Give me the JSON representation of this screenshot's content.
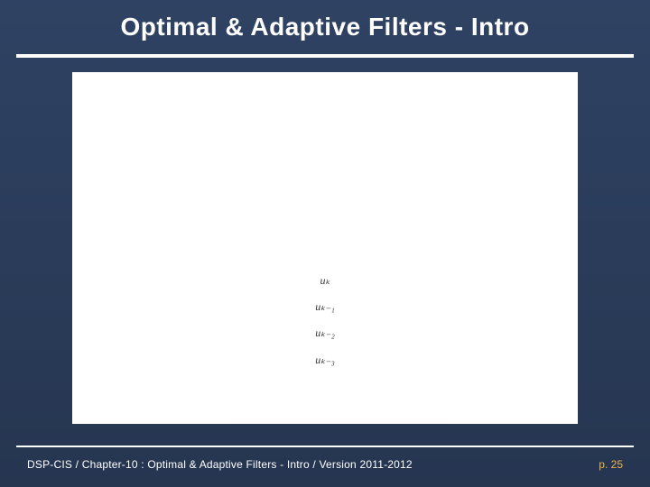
{
  "title": "Optimal & Adaptive Filters - Intro",
  "signals": {
    "s0": "uₖ",
    "s1": "uₖ₋₁",
    "s2": "uₖ₋₂",
    "s3": "uₖ₋₃"
  },
  "footer": {
    "course": "DSP-CIS",
    "sep": "  /  ",
    "chapter": "Chapter-10 : Optimal & Adaptive Filters - Intro",
    "version": "Version 2011-2012",
    "page": "p. 25"
  }
}
